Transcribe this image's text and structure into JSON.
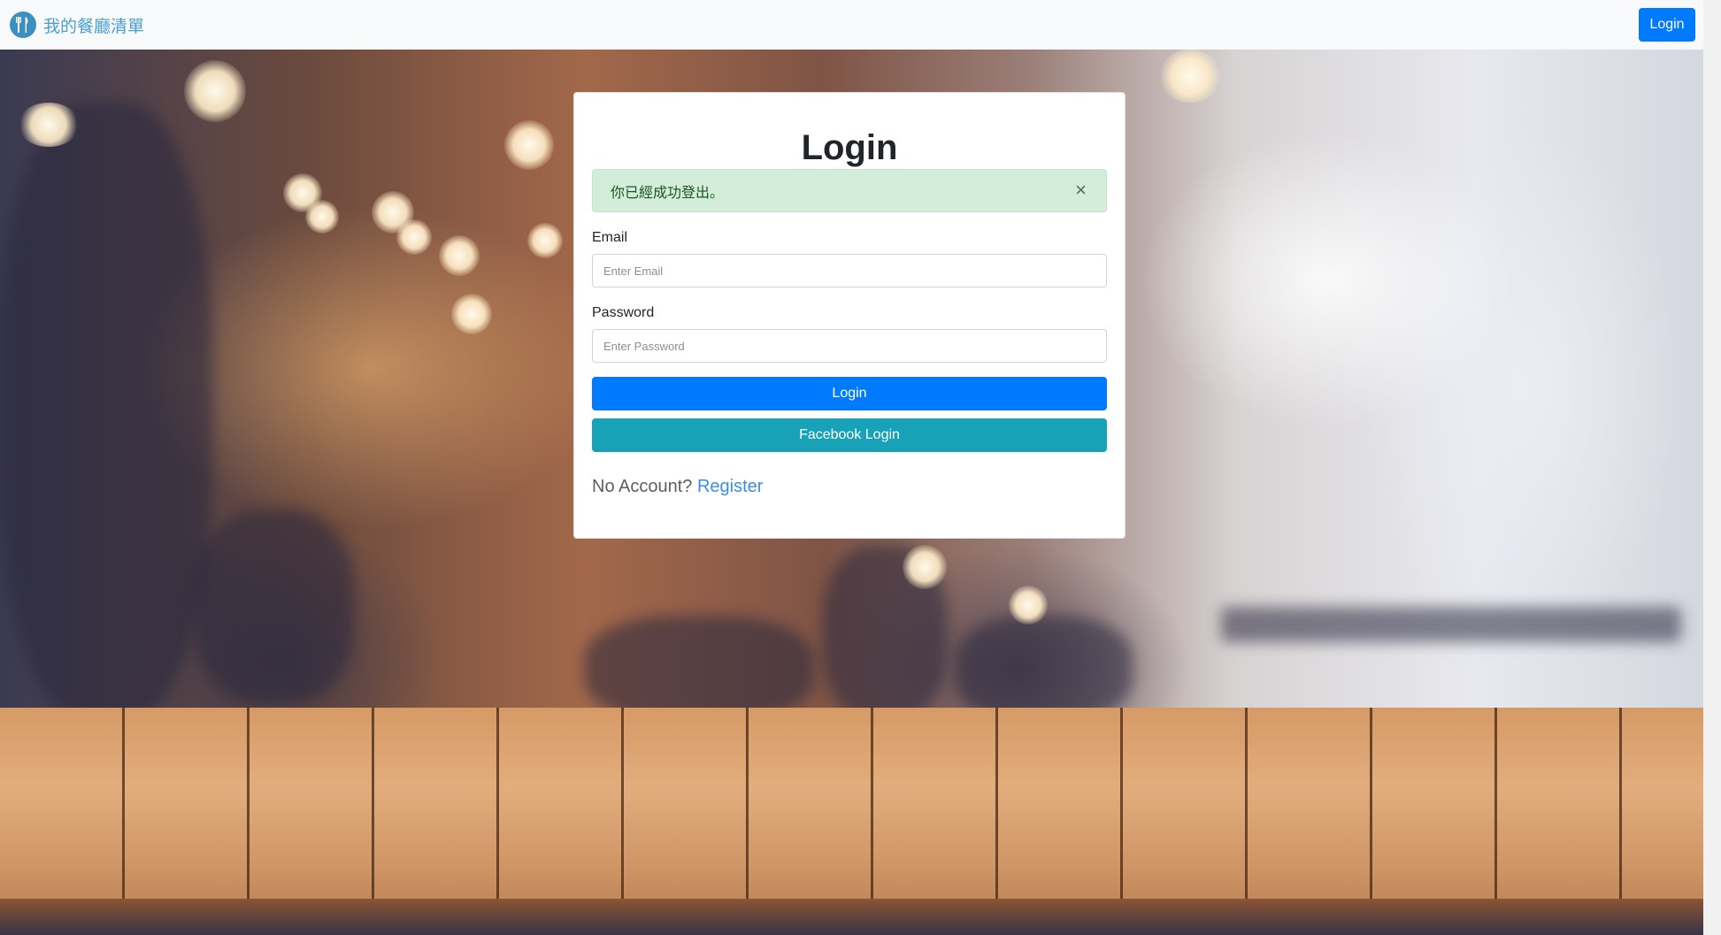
{
  "navbar": {
    "brand_text": "我的餐廳清單",
    "brand_icon": "utensils-icon",
    "login_button": "Login"
  },
  "card": {
    "title": "Login",
    "alert": {
      "message": "你已經成功登出。",
      "close_symbol": "×"
    },
    "email": {
      "label": "Email",
      "placeholder": "Enter Email",
      "value": ""
    },
    "password": {
      "label": "Password",
      "placeholder": "Enter Password",
      "value": ""
    },
    "login_button": "Login",
    "facebook_button": "Facebook Login",
    "no_account_text": "No Account?",
    "register_link": "Register"
  },
  "colors": {
    "primary": "#007bff",
    "info": "#17a2b8",
    "alert_bg": "#d4edda",
    "link": "#3a8ee6"
  }
}
